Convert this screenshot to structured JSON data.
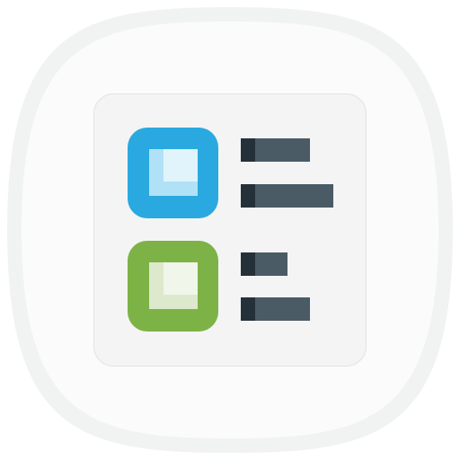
{
  "app_icon": {
    "name": "checklist-app-icon",
    "colors": {
      "outer_ring": "#F1F3F2",
      "outer_fill": "#FBFBFB",
      "card_fill": "#F4F4F4",
      "card_border": "#E3E3E3",
      "blue": "#2AA9E0",
      "blue_inner_light": "#E1F4FC",
      "blue_inner_shade": "#B1E1F7",
      "green": "#7DB246",
      "green_inner_light": "#F1F6EA",
      "green_inner_shade": "#DCE9CC",
      "line_dark": "#24313A",
      "line_main": "#4A5B66"
    },
    "items": [
      {
        "name": "checkbox-blue",
        "lines": 2
      },
      {
        "name": "checkbox-green",
        "lines": 2
      }
    ]
  }
}
